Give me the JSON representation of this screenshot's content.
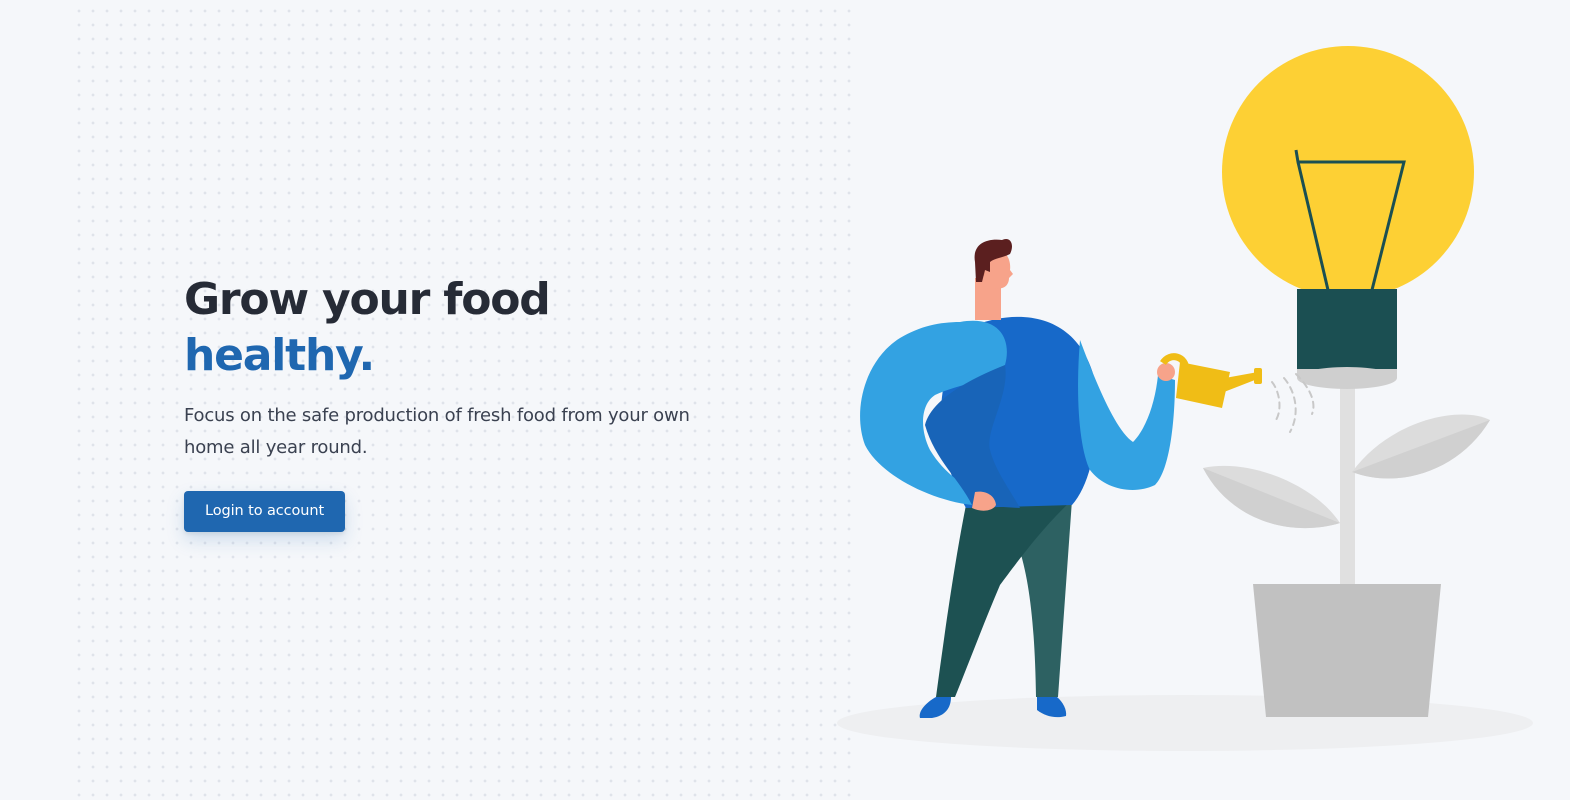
{
  "hero": {
    "title_line1": "Grow your food",
    "title_line2": "healthy.",
    "description": "Focus on the safe production of fresh food from your own home all year round.",
    "login_button": "Login to account"
  },
  "colors": {
    "background": "#f5f7fa",
    "title": "#262b36",
    "accent": "#1f67b0",
    "body_text": "#3a4150",
    "bulb_yellow": "#fdd034",
    "bulb_base": "#1b4f52",
    "shirt_light": "#33a2e2",
    "shirt_dark": "#1769c9",
    "pants": "#1d5152",
    "pot": "#c1c1c1"
  },
  "illustration": {
    "icon": "person-watering-lightbulb-plant-illustration"
  }
}
